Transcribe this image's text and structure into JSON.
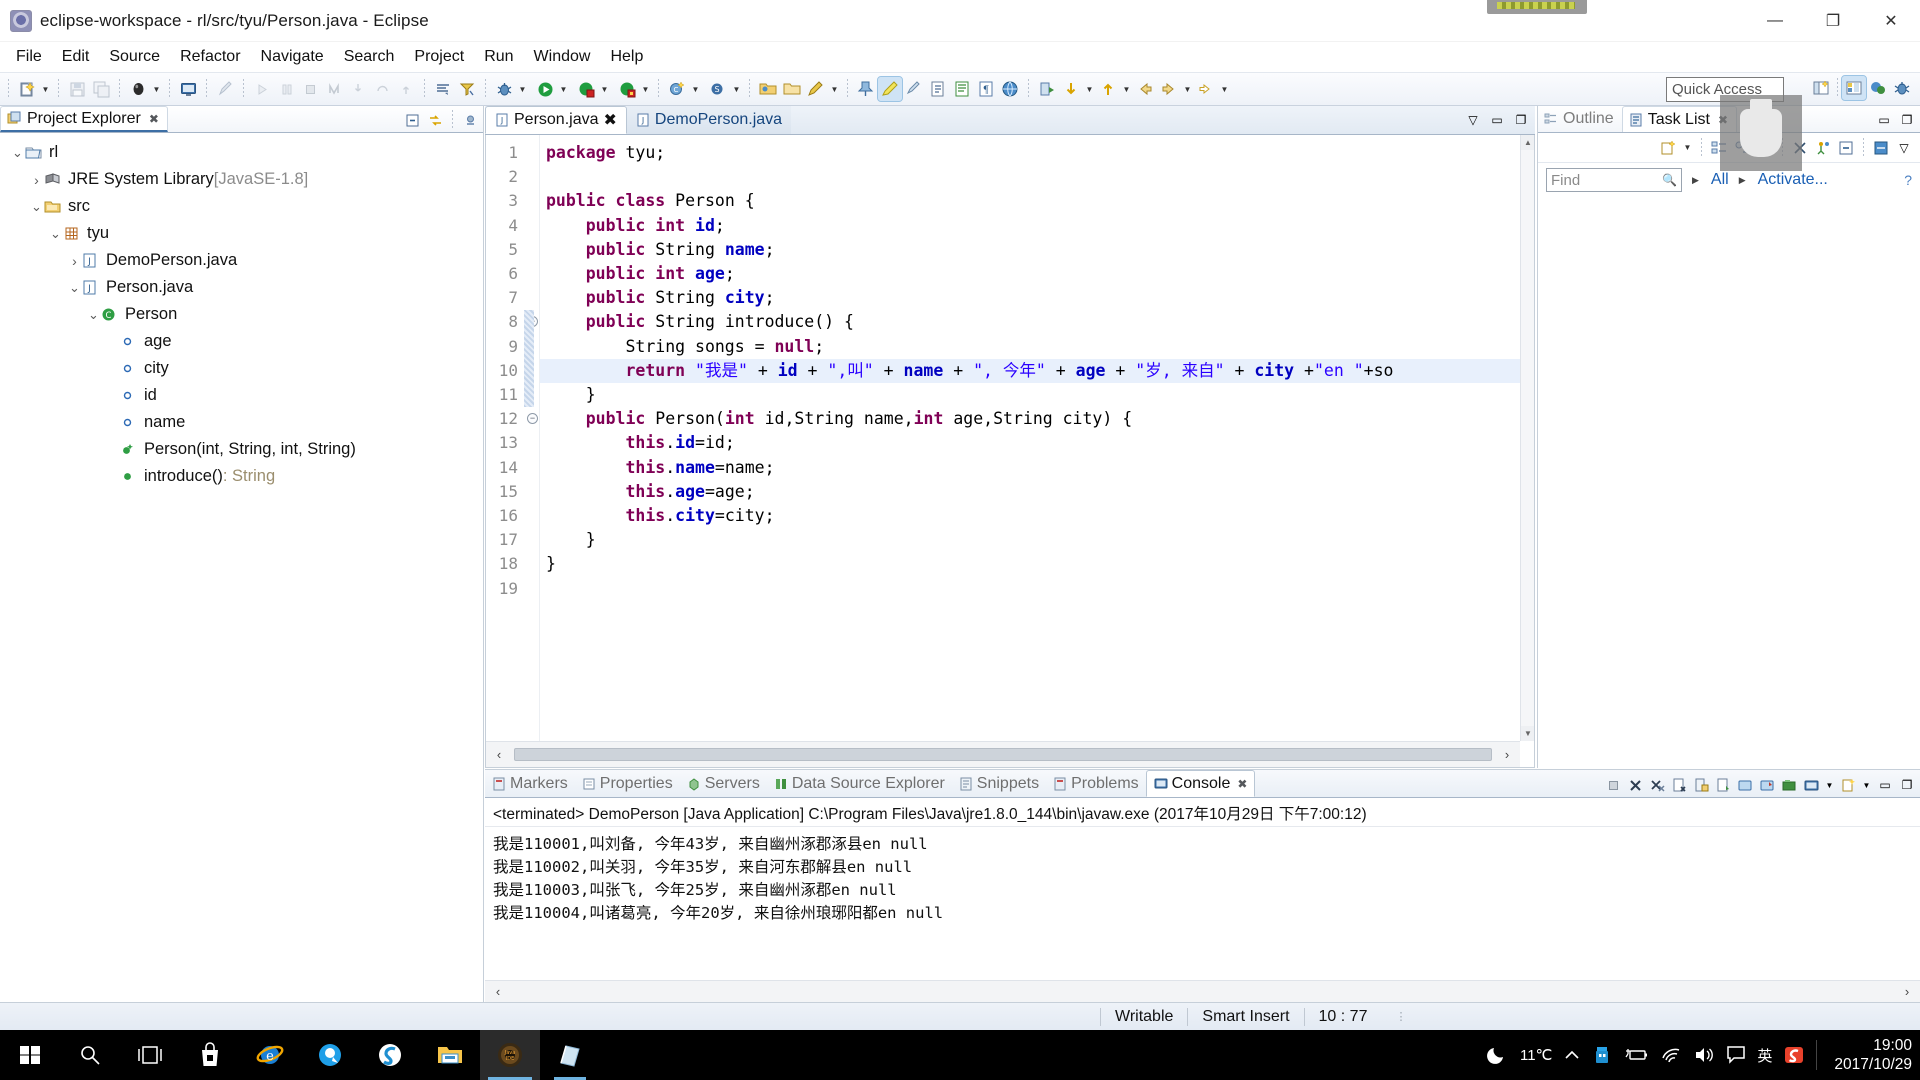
{
  "window": {
    "title": "eclipse-workspace - rl/src/tyu/Person.java - Eclipse",
    "minimize": "—",
    "maximize": "❐",
    "close": "✕"
  },
  "menubar": {
    "items": [
      "File",
      "Edit",
      "Source",
      "Refactor",
      "Navigate",
      "Search",
      "Project",
      "Run",
      "Window",
      "Help"
    ]
  },
  "toolbar": {
    "quick_access_placeholder": "Quick Access"
  },
  "explorer": {
    "tab_label": "Project Explorer",
    "close_glyph": "✖",
    "tree": [
      {
        "indent": 0,
        "twisty": "v",
        "icon": "project-icon",
        "label": "rl",
        "type": ""
      },
      {
        "indent": 1,
        "twisty": ">",
        "icon": "library-icon",
        "label": "JRE System Library ",
        "type": "[JavaSE-1.8]"
      },
      {
        "indent": 1,
        "twisty": "v",
        "icon": "source-folder-icon",
        "label": "src",
        "type": ""
      },
      {
        "indent": 2,
        "twisty": "v",
        "icon": "package-icon",
        "label": "tyu",
        "type": ""
      },
      {
        "indent": 3,
        "twisty": ">",
        "icon": "java-file-icon",
        "label": "DemoPerson.java",
        "type": ""
      },
      {
        "indent": 3,
        "twisty": "v",
        "icon": "java-file-icon",
        "label": "Person.java",
        "type": ""
      },
      {
        "indent": 4,
        "twisty": "v",
        "icon": "class-icon",
        "label": "Person",
        "type": ""
      },
      {
        "indent": 5,
        "twisty": "",
        "icon": "field-icon",
        "label": "age",
        "type": ""
      },
      {
        "indent": 5,
        "twisty": "",
        "icon": "field-icon",
        "label": "city",
        "type": ""
      },
      {
        "indent": 5,
        "twisty": "",
        "icon": "field-icon",
        "label": "id",
        "type": ""
      },
      {
        "indent": 5,
        "twisty": "",
        "icon": "field-icon",
        "label": "name",
        "type": ""
      },
      {
        "indent": 5,
        "twisty": "",
        "icon": "constructor-icon",
        "label": "Person(int, String, int, String)",
        "type": ""
      },
      {
        "indent": 5,
        "twisty": "",
        "icon": "method-icon",
        "label": "introduce()",
        "type": " : String"
      }
    ]
  },
  "editor": {
    "tabs": [
      {
        "label": "Person.java",
        "active": true,
        "close_glyph": "✖"
      },
      {
        "label": "DemoPerson.java",
        "active": false,
        "close_glyph": ""
      }
    ],
    "highlight_line": 10,
    "folding_lines": [
      8,
      12
    ],
    "lines": [
      {
        "n": 1,
        "tokens": [
          {
            "c": "k",
            "t": "package"
          },
          {
            "c": "t",
            "t": " tyu;"
          }
        ]
      },
      {
        "n": 2,
        "tokens": []
      },
      {
        "n": 3,
        "tokens": [
          {
            "c": "k",
            "t": "public class"
          },
          {
            "c": "t",
            "t": " Person {"
          }
        ]
      },
      {
        "n": 4,
        "tokens": [
          {
            "c": "t",
            "t": "    "
          },
          {
            "c": "k",
            "t": "public int"
          },
          {
            "c": "t",
            "t": " "
          },
          {
            "c": "f",
            "t": "id"
          },
          {
            "c": "t",
            "t": ";"
          }
        ]
      },
      {
        "n": 5,
        "tokens": [
          {
            "c": "t",
            "t": "    "
          },
          {
            "c": "k",
            "t": "public"
          },
          {
            "c": "t",
            "t": " String "
          },
          {
            "c": "f",
            "t": "name"
          },
          {
            "c": "t",
            "t": ";"
          }
        ]
      },
      {
        "n": 6,
        "tokens": [
          {
            "c": "t",
            "t": "    "
          },
          {
            "c": "k",
            "t": "public int"
          },
          {
            "c": "t",
            "t": " "
          },
          {
            "c": "f",
            "t": "age"
          },
          {
            "c": "t",
            "t": ";"
          }
        ]
      },
      {
        "n": 7,
        "tokens": [
          {
            "c": "t",
            "t": "    "
          },
          {
            "c": "k",
            "t": "public"
          },
          {
            "c": "t",
            "t": " String "
          },
          {
            "c": "f",
            "t": "city"
          },
          {
            "c": "t",
            "t": ";"
          }
        ]
      },
      {
        "n": 8,
        "tokens": [
          {
            "c": "t",
            "t": "    "
          },
          {
            "c": "k",
            "t": "public"
          },
          {
            "c": "t",
            "t": " String introduce() {"
          }
        ]
      },
      {
        "n": 9,
        "tokens": [
          {
            "c": "t",
            "t": "        String songs = "
          },
          {
            "c": "k",
            "t": "null"
          },
          {
            "c": "t",
            "t": ";"
          }
        ]
      },
      {
        "n": 10,
        "tokens": [
          {
            "c": "t",
            "t": "        "
          },
          {
            "c": "k",
            "t": "return"
          },
          {
            "c": "t",
            "t": " "
          },
          {
            "c": "s",
            "t": "\"我是\""
          },
          {
            "c": "t",
            "t": " + "
          },
          {
            "c": "f",
            "t": "id"
          },
          {
            "c": "t",
            "t": " + "
          },
          {
            "c": "s",
            "t": "\",叫\""
          },
          {
            "c": "t",
            "t": " + "
          },
          {
            "c": "f",
            "t": "name"
          },
          {
            "c": "t",
            "t": " + "
          },
          {
            "c": "s",
            "t": "\", 今年\""
          },
          {
            "c": "t",
            "t": " + "
          },
          {
            "c": "f",
            "t": "age"
          },
          {
            "c": "t",
            "t": " + "
          },
          {
            "c": "s",
            "t": "\"岁, 来自\""
          },
          {
            "c": "t",
            "t": " + "
          },
          {
            "c": "f",
            "t": "city"
          },
          {
            "c": "t",
            "t": " +"
          },
          {
            "c": "s",
            "t": "\"en \""
          },
          {
            "c": "t",
            "t": "+so"
          }
        ]
      },
      {
        "n": 11,
        "tokens": [
          {
            "c": "t",
            "t": "    }"
          }
        ]
      },
      {
        "n": 12,
        "tokens": [
          {
            "c": "t",
            "t": "    "
          },
          {
            "c": "k",
            "t": "public"
          },
          {
            "c": "t",
            "t": " Person("
          },
          {
            "c": "k",
            "t": "int"
          },
          {
            "c": "t",
            "t": " id,String name,"
          },
          {
            "c": "k",
            "t": "int"
          },
          {
            "c": "t",
            "t": " age,String city) {"
          }
        ]
      },
      {
        "n": 13,
        "tokens": [
          {
            "c": "t",
            "t": "        "
          },
          {
            "c": "k",
            "t": "this"
          },
          {
            "c": "t",
            "t": "."
          },
          {
            "c": "f",
            "t": "id"
          },
          {
            "c": "t",
            "t": "=id;"
          }
        ]
      },
      {
        "n": 14,
        "tokens": [
          {
            "c": "t",
            "t": "        "
          },
          {
            "c": "k",
            "t": "this"
          },
          {
            "c": "t",
            "t": "."
          },
          {
            "c": "f",
            "t": "name"
          },
          {
            "c": "t",
            "t": "=name;"
          }
        ]
      },
      {
        "n": 15,
        "tokens": [
          {
            "c": "t",
            "t": "        "
          },
          {
            "c": "k",
            "t": "this"
          },
          {
            "c": "t",
            "t": "."
          },
          {
            "c": "f",
            "t": "age"
          },
          {
            "c": "t",
            "t": "=age;"
          }
        ]
      },
      {
        "n": 16,
        "tokens": [
          {
            "c": "t",
            "t": "        "
          },
          {
            "c": "k",
            "t": "this"
          },
          {
            "c": "t",
            "t": "."
          },
          {
            "c": "f",
            "t": "city"
          },
          {
            "c": "t",
            "t": "=city;"
          }
        ]
      },
      {
        "n": 17,
        "tokens": [
          {
            "c": "t",
            "t": "    }"
          }
        ]
      },
      {
        "n": 18,
        "tokens": [
          {
            "c": "t",
            "t": "}"
          }
        ]
      },
      {
        "n": 19,
        "tokens": []
      }
    ]
  },
  "right_stack": {
    "tabs": [
      {
        "label": "Outline",
        "active": false,
        "close_glyph": ""
      },
      {
        "label": "Task List",
        "active": true,
        "close_glyph": "✖"
      }
    ],
    "find_placeholder": "Find",
    "links": [
      "All",
      "Activate..."
    ],
    "help_glyph": "?"
  },
  "bottom_stack": {
    "tabs": [
      {
        "label": "Markers",
        "active": false
      },
      {
        "label": "Properties",
        "active": false
      },
      {
        "label": "Servers",
        "active": false
      },
      {
        "label": "Data Source Explorer",
        "active": false
      },
      {
        "label": "Snippets",
        "active": false
      },
      {
        "label": "Problems",
        "active": false
      },
      {
        "label": "Console",
        "active": true,
        "close_glyph": "✖"
      }
    ],
    "console_header": "<terminated> DemoPerson [Java Application] C:\\Program Files\\Java\\jre1.8.0_144\\bin\\javaw.exe (2017年10月29日 下午7:00:12)",
    "console_lines": [
      "我是110001,叫刘备, 今年43岁, 来自幽州涿郡涿县en null",
      "我是110002,叫关羽, 今年35岁, 来自河东郡解县en null",
      "我是110003,叫张飞, 今年25岁, 来自幽州涿郡en null",
      "我是110004,叫诸葛亮, 今年20岁, 来自徐州琅琊阳都en null"
    ]
  },
  "statusbar": {
    "writable": "Writable",
    "insert_mode": "Smart Insert",
    "cursor_position": "10 : 77"
  },
  "taskbar": {
    "buttons": [
      "start-icon",
      "search-icon",
      "task-view-icon",
      "microsoft-store-icon",
      "internet-explorer-icon",
      "qq-browser-icon",
      "sogou-icon",
      "file-explorer-icon",
      "eclipse-icon",
      "notepad-icon"
    ],
    "tray": {
      "weather": "11℃",
      "time": "19:00",
      "date": "2017/10/29",
      "ime": "英"
    }
  },
  "colors": {
    "keyword": "#7f0055",
    "string": "#2a00ff",
    "field": "#0000c0",
    "link": "#1a5fb4",
    "selection": "#e8f0fc"
  }
}
